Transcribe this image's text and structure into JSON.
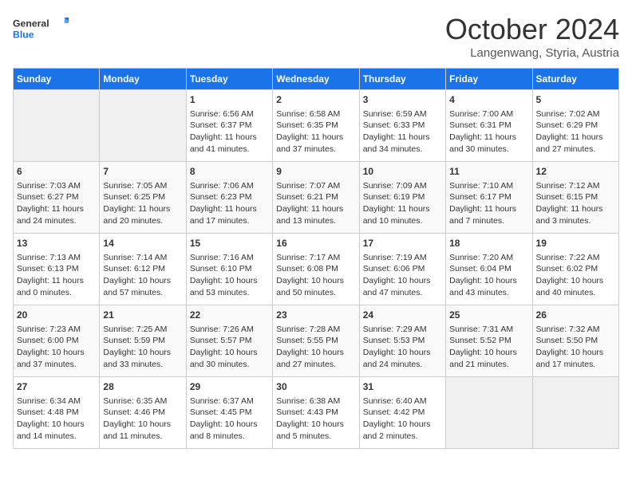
{
  "logo": {
    "line1": "General",
    "line2": "Blue"
  },
  "title": "October 2024",
  "subtitle": "Langenwang, Styria, Austria",
  "weekdays": [
    "Sunday",
    "Monday",
    "Tuesday",
    "Wednesday",
    "Thursday",
    "Friday",
    "Saturday"
  ],
  "weeks": [
    [
      {
        "day": "",
        "content": ""
      },
      {
        "day": "",
        "content": ""
      },
      {
        "day": "1",
        "content": "Sunrise: 6:56 AM\nSunset: 6:37 PM\nDaylight: 11 hours\nand 41 minutes."
      },
      {
        "day": "2",
        "content": "Sunrise: 6:58 AM\nSunset: 6:35 PM\nDaylight: 11 hours\nand 37 minutes."
      },
      {
        "day": "3",
        "content": "Sunrise: 6:59 AM\nSunset: 6:33 PM\nDaylight: 11 hours\nand 34 minutes."
      },
      {
        "day": "4",
        "content": "Sunrise: 7:00 AM\nSunset: 6:31 PM\nDaylight: 11 hours\nand 30 minutes."
      },
      {
        "day": "5",
        "content": "Sunrise: 7:02 AM\nSunset: 6:29 PM\nDaylight: 11 hours\nand 27 minutes."
      }
    ],
    [
      {
        "day": "6",
        "content": "Sunrise: 7:03 AM\nSunset: 6:27 PM\nDaylight: 11 hours\nand 24 minutes."
      },
      {
        "day": "7",
        "content": "Sunrise: 7:05 AM\nSunset: 6:25 PM\nDaylight: 11 hours\nand 20 minutes."
      },
      {
        "day": "8",
        "content": "Sunrise: 7:06 AM\nSunset: 6:23 PM\nDaylight: 11 hours\nand 17 minutes."
      },
      {
        "day": "9",
        "content": "Sunrise: 7:07 AM\nSunset: 6:21 PM\nDaylight: 11 hours\nand 13 minutes."
      },
      {
        "day": "10",
        "content": "Sunrise: 7:09 AM\nSunset: 6:19 PM\nDaylight: 11 hours\nand 10 minutes."
      },
      {
        "day": "11",
        "content": "Sunrise: 7:10 AM\nSunset: 6:17 PM\nDaylight: 11 hours\nand 7 minutes."
      },
      {
        "day": "12",
        "content": "Sunrise: 7:12 AM\nSunset: 6:15 PM\nDaylight: 11 hours\nand 3 minutes."
      }
    ],
    [
      {
        "day": "13",
        "content": "Sunrise: 7:13 AM\nSunset: 6:13 PM\nDaylight: 11 hours\nand 0 minutes."
      },
      {
        "day": "14",
        "content": "Sunrise: 7:14 AM\nSunset: 6:12 PM\nDaylight: 10 hours\nand 57 minutes."
      },
      {
        "day": "15",
        "content": "Sunrise: 7:16 AM\nSunset: 6:10 PM\nDaylight: 10 hours\nand 53 minutes."
      },
      {
        "day": "16",
        "content": "Sunrise: 7:17 AM\nSunset: 6:08 PM\nDaylight: 10 hours\nand 50 minutes."
      },
      {
        "day": "17",
        "content": "Sunrise: 7:19 AM\nSunset: 6:06 PM\nDaylight: 10 hours\nand 47 minutes."
      },
      {
        "day": "18",
        "content": "Sunrise: 7:20 AM\nSunset: 6:04 PM\nDaylight: 10 hours\nand 43 minutes."
      },
      {
        "day": "19",
        "content": "Sunrise: 7:22 AM\nSunset: 6:02 PM\nDaylight: 10 hours\nand 40 minutes."
      }
    ],
    [
      {
        "day": "20",
        "content": "Sunrise: 7:23 AM\nSunset: 6:00 PM\nDaylight: 10 hours\nand 37 minutes."
      },
      {
        "day": "21",
        "content": "Sunrise: 7:25 AM\nSunset: 5:59 PM\nDaylight: 10 hours\nand 33 minutes."
      },
      {
        "day": "22",
        "content": "Sunrise: 7:26 AM\nSunset: 5:57 PM\nDaylight: 10 hours\nand 30 minutes."
      },
      {
        "day": "23",
        "content": "Sunrise: 7:28 AM\nSunset: 5:55 PM\nDaylight: 10 hours\nand 27 minutes."
      },
      {
        "day": "24",
        "content": "Sunrise: 7:29 AM\nSunset: 5:53 PM\nDaylight: 10 hours\nand 24 minutes."
      },
      {
        "day": "25",
        "content": "Sunrise: 7:31 AM\nSunset: 5:52 PM\nDaylight: 10 hours\nand 21 minutes."
      },
      {
        "day": "26",
        "content": "Sunrise: 7:32 AM\nSunset: 5:50 PM\nDaylight: 10 hours\nand 17 minutes."
      }
    ],
    [
      {
        "day": "27",
        "content": "Sunrise: 6:34 AM\nSunset: 4:48 PM\nDaylight: 10 hours\nand 14 minutes."
      },
      {
        "day": "28",
        "content": "Sunrise: 6:35 AM\nSunset: 4:46 PM\nDaylight: 10 hours\nand 11 minutes."
      },
      {
        "day": "29",
        "content": "Sunrise: 6:37 AM\nSunset: 4:45 PM\nDaylight: 10 hours\nand 8 minutes."
      },
      {
        "day": "30",
        "content": "Sunrise: 6:38 AM\nSunset: 4:43 PM\nDaylight: 10 hours\nand 5 minutes."
      },
      {
        "day": "31",
        "content": "Sunrise: 6:40 AM\nSunset: 4:42 PM\nDaylight: 10 hours\nand 2 minutes."
      },
      {
        "day": "",
        "content": ""
      },
      {
        "day": "",
        "content": ""
      }
    ]
  ]
}
